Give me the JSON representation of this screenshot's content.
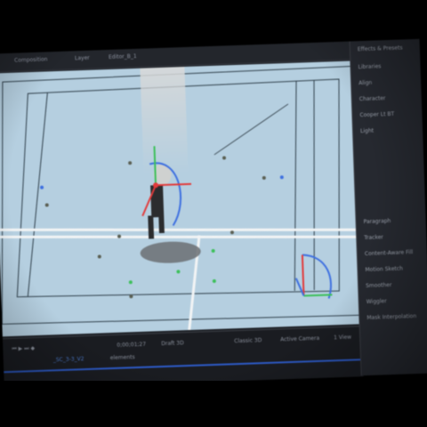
{
  "app": {
    "panel_tab_label": "Effects & Presets"
  },
  "topbar": {
    "tabs": [
      "Composition",
      "Layer",
      "Editor_B_1"
    ]
  },
  "right_panel": {
    "items": [
      "Libraries",
      "Align",
      "Character",
      "Cooper Lt BT",
      "Light",
      "Paragraph",
      "Tracker",
      "Content-Aware Fill",
      "Motion Sketch",
      "Smoother",
      "Wiggler",
      "Mask Interpolation"
    ]
  },
  "timeline": {
    "timecode": "0;00;01;27",
    "layer_name": "_SC_3-3_V2",
    "precomp_name": "elements",
    "render_label": "Draft 3D",
    "track_label": "Classic 3D",
    "camera_label": "Active Camera",
    "view_label": "1 View"
  },
  "colors": {
    "viewer_bg": "#b5cfe0",
    "court_lines": "#2f3f4a",
    "axis_red": "#e23a3a",
    "axis_green": "#3cc05a",
    "axis_blue": "#3d6fe0",
    "timeline_accent": "#2d5ac6"
  }
}
